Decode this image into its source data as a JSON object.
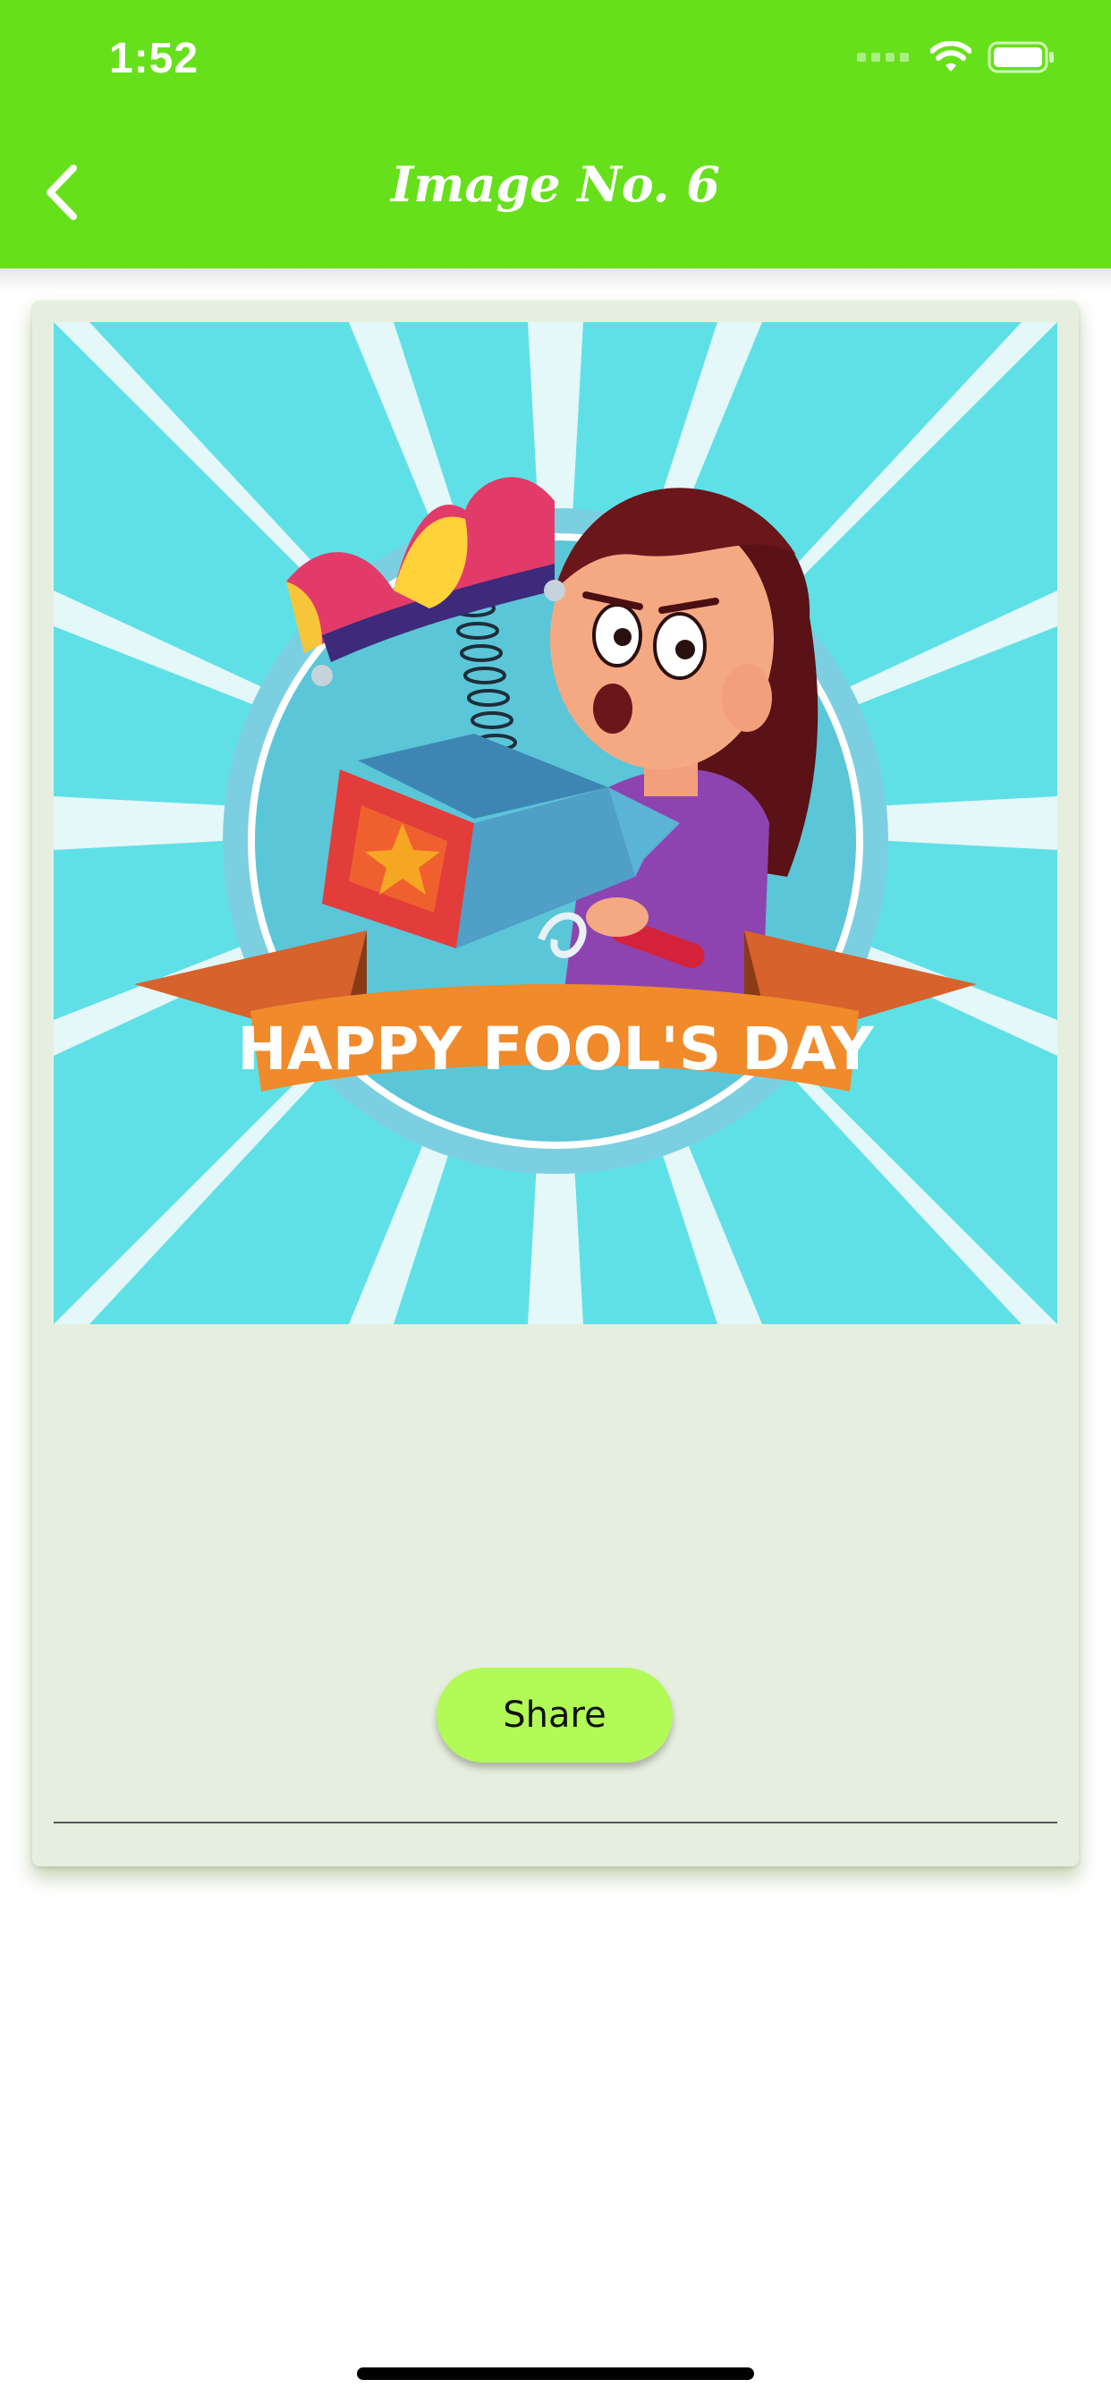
{
  "status_bar": {
    "time": "1:52",
    "icons": [
      "signal-icon",
      "wifi-icon",
      "battery-icon"
    ]
  },
  "header": {
    "title": "Image No. 6",
    "back_icon": "chevron-left-icon",
    "background_color": "#66e01a"
  },
  "card": {
    "image": {
      "banner_text": "HAPPY FOOL'S DAY"
    },
    "share_label": "Share",
    "share_color": "#b2fa55",
    "background_color": "#e6efdf"
  }
}
